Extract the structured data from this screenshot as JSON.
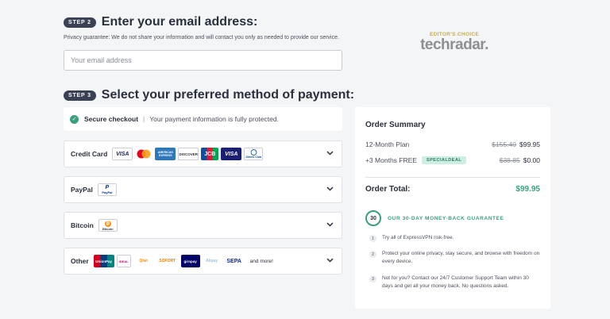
{
  "step2": {
    "badge": "STEP 2",
    "title": "Enter your email address:"
  },
  "privacy": "Privacy guarantee: We do not share your information and will contact you only as needed to provide our service.",
  "email": {
    "placeholder": "Your email address",
    "value": ""
  },
  "techradar": {
    "editor": "EDITOR'S CHOICE",
    "logo": "techradar."
  },
  "step3": {
    "badge": "STEP 3",
    "title": "Select your preferred method of payment:"
  },
  "secure": {
    "label": "Secure checkout",
    "separator": "|",
    "message": "Your payment information is fully protected."
  },
  "payments": [
    {
      "label": "Credit Card",
      "logos": [
        "VISA",
        "Mastercard",
        "AMERICAN EXPRESS",
        "DISCOVER",
        "JCB",
        "VISA",
        "Diners Club"
      ]
    },
    {
      "label": "PayPal",
      "logos": [
        "PayPal"
      ]
    },
    {
      "label": "Bitcoin",
      "logos": [
        "Bitcoin"
      ]
    },
    {
      "label": "Other",
      "logos": [
        "UnionPay",
        "iDEAL",
        "Qiwi",
        "SOFORT",
        "giropay",
        "Alipay",
        "SEPA"
      ],
      "more": "and more!"
    }
  ],
  "summary": {
    "title": "Order Summary",
    "lines": [
      {
        "label": "12-Month Plan",
        "old": "$155.40",
        "price": "$99.95"
      },
      {
        "label": "+3 Months FREE",
        "tag": "SPECIALDEAL",
        "old": "$38.85",
        "price": "$0.00"
      }
    ],
    "total_label": "Order Total:",
    "total_value": "$99.95",
    "guarantee_badge": "30",
    "guarantee_title": "OUR 30-DAY MONEY-BACK GUARANTEE",
    "items": [
      {
        "num": "1",
        "text": "Try all of ExpressVPN risk-free."
      },
      {
        "num": "2",
        "text": "Protect your online privacy, stay secure, and browse with freedom on every device."
      },
      {
        "num": "3",
        "text": "Not for you? Contact our 24/7 Customer Support Team within 30 days and get all your money back. No questions asked."
      }
    ]
  },
  "colors": {
    "accent": "#3a9f7e",
    "pill": "#3a4154",
    "background": "#f4f5f7"
  }
}
